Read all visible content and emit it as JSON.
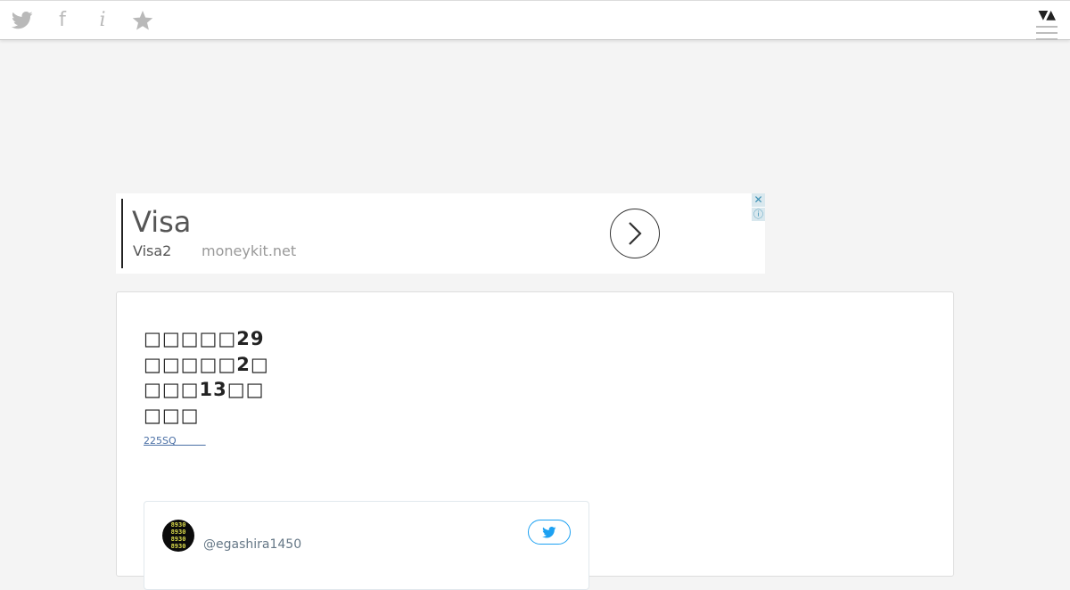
{
  "toolbar": {
    "icons": [
      "twitter-icon",
      "facebook-icon",
      "info-icon",
      "star-icon"
    ],
    "facebook_glyph": "f",
    "info_glyph": "i",
    "sort_toggle": "▼▲",
    "icon_color": "#b9b9b9"
  },
  "ad": {
    "title": "Visa",
    "subtitle": "Visa2",
    "domain": "moneykit.net",
    "close_glyph": "✕",
    "info_glyph": "ⓘ"
  },
  "post": {
    "lines": [
      "□□□□□29",
      "□□□□□2□",
      "□□□13□□",
      "□□□"
    ],
    "link_text": "225SQ　　　"
  },
  "embed": {
    "avatar_lines": [
      "8930",
      "8930",
      "8930",
      "8930"
    ],
    "handle": "@egashira1450",
    "accent_color": "#1da1f2"
  }
}
